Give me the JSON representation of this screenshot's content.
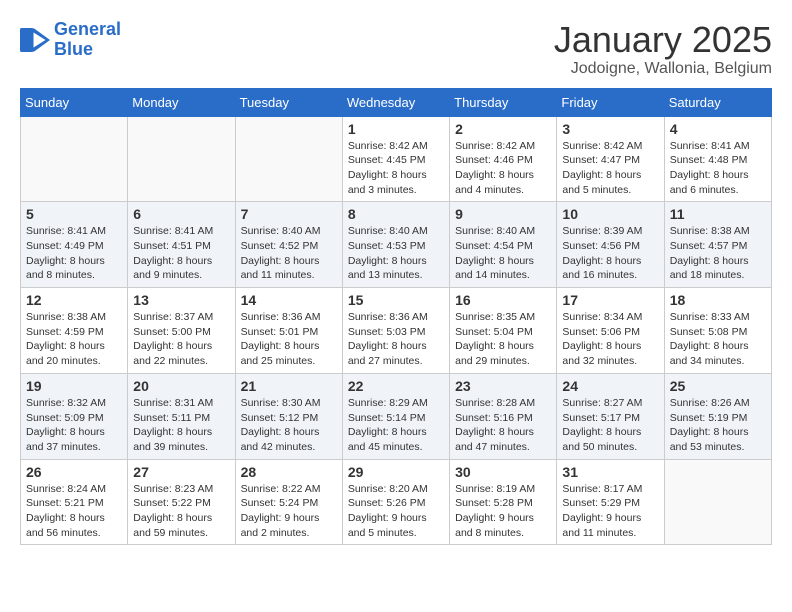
{
  "header": {
    "logo_line1": "General",
    "logo_line2": "Blue",
    "title": "January 2025",
    "subtitle": "Jodoigne, Wallonia, Belgium"
  },
  "weekdays": [
    "Sunday",
    "Monday",
    "Tuesday",
    "Wednesday",
    "Thursday",
    "Friday",
    "Saturday"
  ],
  "weeks": [
    [
      {
        "day": "",
        "info": ""
      },
      {
        "day": "",
        "info": ""
      },
      {
        "day": "",
        "info": ""
      },
      {
        "day": "1",
        "info": "Sunrise: 8:42 AM\nSunset: 4:45 PM\nDaylight: 8 hours and 3 minutes."
      },
      {
        "day": "2",
        "info": "Sunrise: 8:42 AM\nSunset: 4:46 PM\nDaylight: 8 hours and 4 minutes."
      },
      {
        "day": "3",
        "info": "Sunrise: 8:42 AM\nSunset: 4:47 PM\nDaylight: 8 hours and 5 minutes."
      },
      {
        "day": "4",
        "info": "Sunrise: 8:41 AM\nSunset: 4:48 PM\nDaylight: 8 hours and 6 minutes."
      }
    ],
    [
      {
        "day": "5",
        "info": "Sunrise: 8:41 AM\nSunset: 4:49 PM\nDaylight: 8 hours and 8 minutes."
      },
      {
        "day": "6",
        "info": "Sunrise: 8:41 AM\nSunset: 4:51 PM\nDaylight: 8 hours and 9 minutes."
      },
      {
        "day": "7",
        "info": "Sunrise: 8:40 AM\nSunset: 4:52 PM\nDaylight: 8 hours and 11 minutes."
      },
      {
        "day": "8",
        "info": "Sunrise: 8:40 AM\nSunset: 4:53 PM\nDaylight: 8 hours and 13 minutes."
      },
      {
        "day": "9",
        "info": "Sunrise: 8:40 AM\nSunset: 4:54 PM\nDaylight: 8 hours and 14 minutes."
      },
      {
        "day": "10",
        "info": "Sunrise: 8:39 AM\nSunset: 4:56 PM\nDaylight: 8 hours and 16 minutes."
      },
      {
        "day": "11",
        "info": "Sunrise: 8:38 AM\nSunset: 4:57 PM\nDaylight: 8 hours and 18 minutes."
      }
    ],
    [
      {
        "day": "12",
        "info": "Sunrise: 8:38 AM\nSunset: 4:59 PM\nDaylight: 8 hours and 20 minutes."
      },
      {
        "day": "13",
        "info": "Sunrise: 8:37 AM\nSunset: 5:00 PM\nDaylight: 8 hours and 22 minutes."
      },
      {
        "day": "14",
        "info": "Sunrise: 8:36 AM\nSunset: 5:01 PM\nDaylight: 8 hours and 25 minutes."
      },
      {
        "day": "15",
        "info": "Sunrise: 8:36 AM\nSunset: 5:03 PM\nDaylight: 8 hours and 27 minutes."
      },
      {
        "day": "16",
        "info": "Sunrise: 8:35 AM\nSunset: 5:04 PM\nDaylight: 8 hours and 29 minutes."
      },
      {
        "day": "17",
        "info": "Sunrise: 8:34 AM\nSunset: 5:06 PM\nDaylight: 8 hours and 32 minutes."
      },
      {
        "day": "18",
        "info": "Sunrise: 8:33 AM\nSunset: 5:08 PM\nDaylight: 8 hours and 34 minutes."
      }
    ],
    [
      {
        "day": "19",
        "info": "Sunrise: 8:32 AM\nSunset: 5:09 PM\nDaylight: 8 hours and 37 minutes."
      },
      {
        "day": "20",
        "info": "Sunrise: 8:31 AM\nSunset: 5:11 PM\nDaylight: 8 hours and 39 minutes."
      },
      {
        "day": "21",
        "info": "Sunrise: 8:30 AM\nSunset: 5:12 PM\nDaylight: 8 hours and 42 minutes."
      },
      {
        "day": "22",
        "info": "Sunrise: 8:29 AM\nSunset: 5:14 PM\nDaylight: 8 hours and 45 minutes."
      },
      {
        "day": "23",
        "info": "Sunrise: 8:28 AM\nSunset: 5:16 PM\nDaylight: 8 hours and 47 minutes."
      },
      {
        "day": "24",
        "info": "Sunrise: 8:27 AM\nSunset: 5:17 PM\nDaylight: 8 hours and 50 minutes."
      },
      {
        "day": "25",
        "info": "Sunrise: 8:26 AM\nSunset: 5:19 PM\nDaylight: 8 hours and 53 minutes."
      }
    ],
    [
      {
        "day": "26",
        "info": "Sunrise: 8:24 AM\nSunset: 5:21 PM\nDaylight: 8 hours and 56 minutes."
      },
      {
        "day": "27",
        "info": "Sunrise: 8:23 AM\nSunset: 5:22 PM\nDaylight: 8 hours and 59 minutes."
      },
      {
        "day": "28",
        "info": "Sunrise: 8:22 AM\nSunset: 5:24 PM\nDaylight: 9 hours and 2 minutes."
      },
      {
        "day": "29",
        "info": "Sunrise: 8:20 AM\nSunset: 5:26 PM\nDaylight: 9 hours and 5 minutes."
      },
      {
        "day": "30",
        "info": "Sunrise: 8:19 AM\nSunset: 5:28 PM\nDaylight: 9 hours and 8 minutes."
      },
      {
        "day": "31",
        "info": "Sunrise: 8:17 AM\nSunset: 5:29 PM\nDaylight: 9 hours and 11 minutes."
      },
      {
        "day": "",
        "info": ""
      }
    ]
  ]
}
